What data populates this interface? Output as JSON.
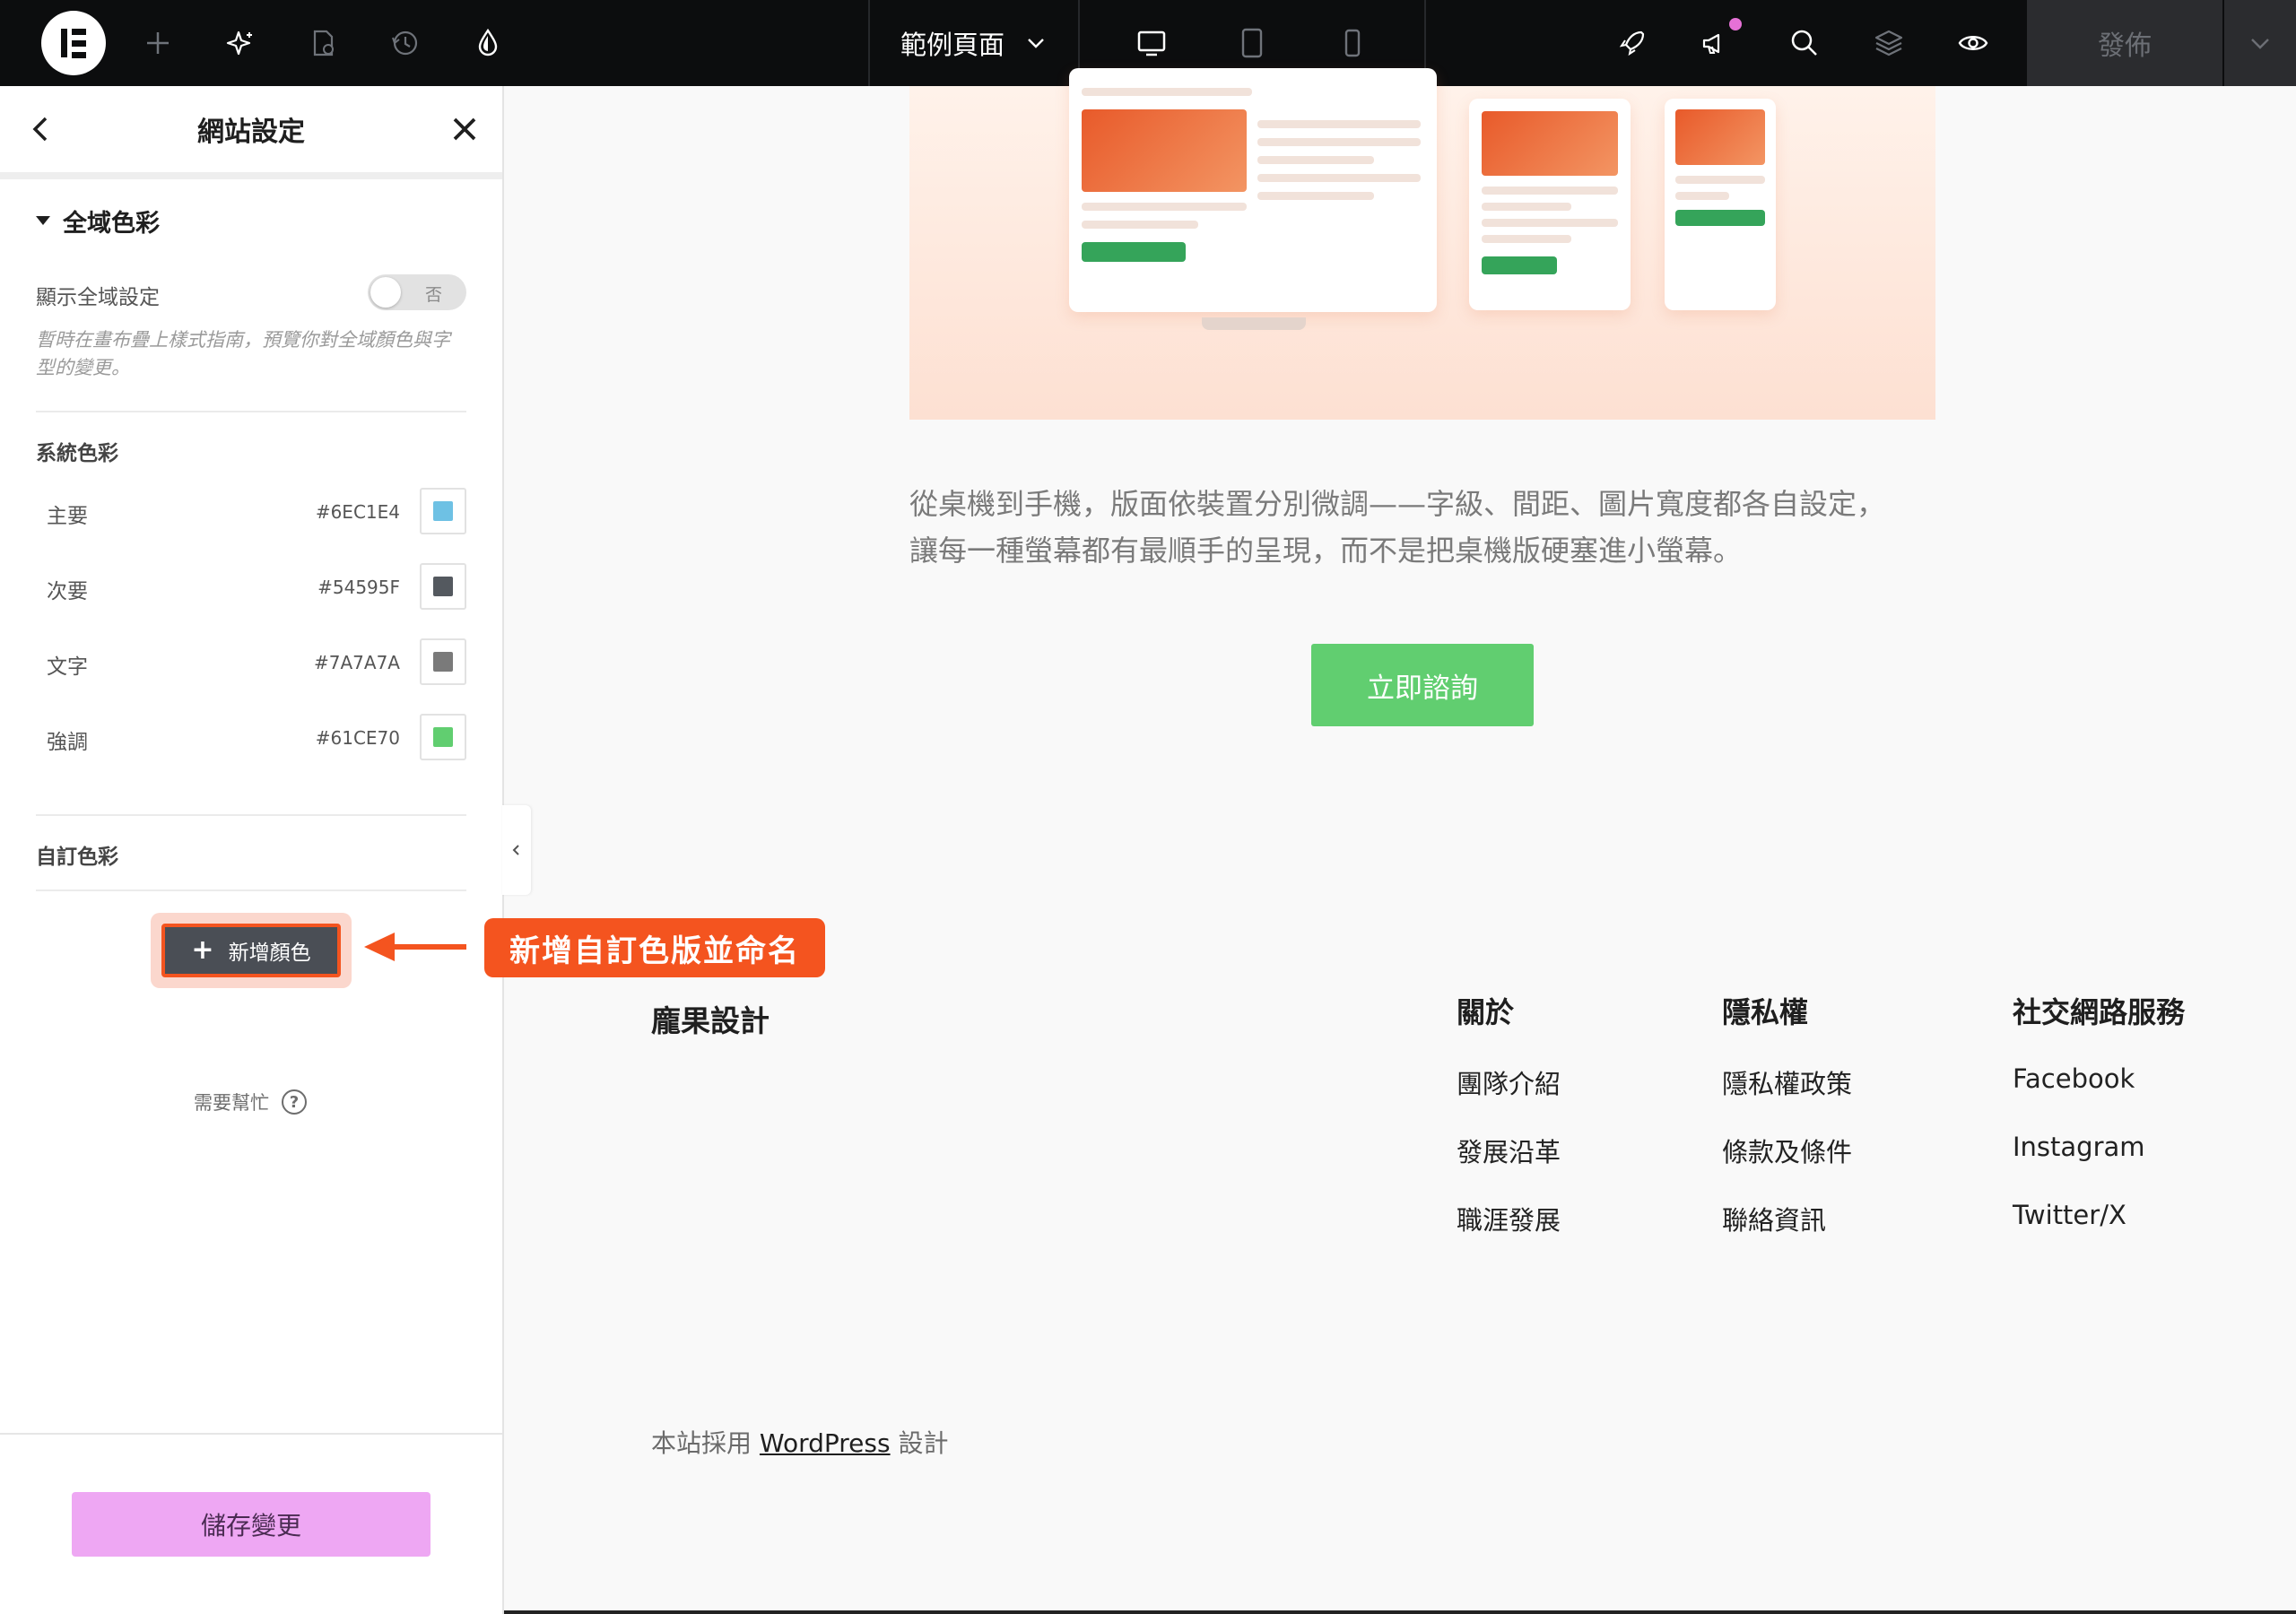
{
  "topbar": {
    "page_name": "範例頁面",
    "publish_label": "發佈",
    "colors": {
      "bg": "#0c0d0e",
      "icon": "#ffffff",
      "dim_icon": "#6f737a",
      "notify": "#e671d6"
    }
  },
  "panel": {
    "title": "網站設定",
    "section_title": "全域色彩",
    "show_global_label": "顯示全域設定",
    "toggle_state": "否",
    "help_text": "暫時在畫布疊上樣式指南，預覽你對全域顏色與字型的變更。",
    "system_colors_title": "系統色彩",
    "system_colors": [
      {
        "name": "主要",
        "hex": "#6EC1E4"
      },
      {
        "name": "次要",
        "hex": "#54595F"
      },
      {
        "name": "文字",
        "hex": "#7A7A7A"
      },
      {
        "name": "強調",
        "hex": "#61CE70"
      }
    ],
    "custom_colors_title": "自訂色彩",
    "add_color_label": "新增顏色",
    "need_help": "需要幫忙",
    "save_label": "儲存變更"
  },
  "annotation": {
    "label": "新增自訂色版並命名",
    "color": "#f4541f"
  },
  "canvas": {
    "intro_line1": "從桌機到手機，版面依裝置分別微調——字級、間距、圖片寬度都各自設定，",
    "intro_line2": "讓每一種螢幕都有最順手的呈現，而不是把桌機版硬塞進小螢幕。",
    "cta_label": "立即諮詢",
    "footer": {
      "brand": "龐果設計",
      "columns": [
        {
          "heading": "關於",
          "links": [
            "團隊介紹",
            "發展沿革",
            "職涯發展"
          ]
        },
        {
          "heading": "隱私權",
          "links": [
            "隱私權政策",
            "條款及條件",
            "聯絡資訊"
          ]
        },
        {
          "heading": "社交網路服務",
          "links": [
            "Facebook",
            "Instagram",
            "Twitter/X"
          ]
        }
      ],
      "copyright_prefix": "本站採用",
      "copyright_link": "WordPress",
      "copyright_suffix": "設計"
    }
  }
}
